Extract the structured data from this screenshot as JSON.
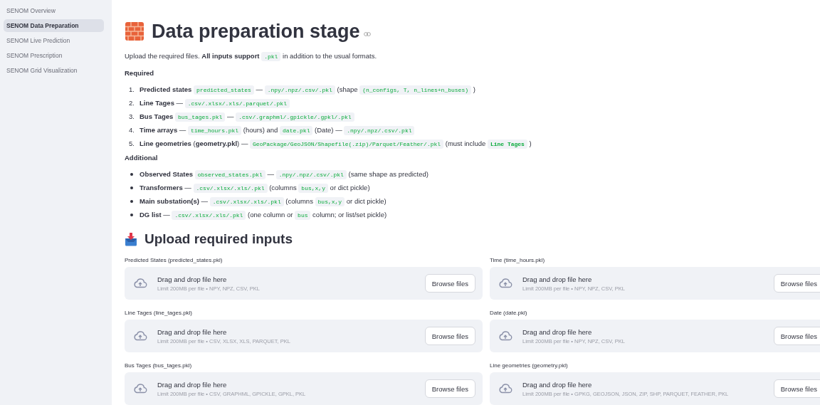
{
  "sidebar": {
    "items": [
      {
        "label": "SENOM Overview",
        "selected": false
      },
      {
        "label": "SENOM Data Preparation",
        "selected": true
      },
      {
        "label": "SENOM Live Prediction",
        "selected": false
      },
      {
        "label": "SENOM Prescription",
        "selected": false
      },
      {
        "label": "SENOM Grid Visualization",
        "selected": false
      }
    ]
  },
  "title": "Data preparation stage",
  "intro": [
    {
      "kind": "text",
      "text": "Upload the required files. "
    },
    {
      "kind": "bold",
      "text": "All inputs support "
    },
    {
      "kind": "code",
      "text": ".pkl"
    },
    {
      "kind": "text",
      "text": " in addition to the usual formats."
    }
  ],
  "required": {
    "heading": "Required",
    "items": [
      {
        "number": "1.",
        "parts": [
          {
            "kind": "bold",
            "text": "Predicted states "
          },
          {
            "kind": "code",
            "text": "predicted_states"
          },
          {
            "kind": "text",
            "text": " — "
          },
          {
            "kind": "code",
            "text": ".npy/.npz/.csv/.pkl"
          },
          {
            "kind": "text",
            "text": " (shape "
          },
          {
            "kind": "code",
            "text": "(n_configs, T, n_lines+n_buses)"
          },
          {
            "kind": "text",
            "text": " )"
          }
        ]
      },
      {
        "number": "2.",
        "parts": [
          {
            "kind": "bold",
            "text": "Line Tages"
          },
          {
            "kind": "text",
            "text": " — "
          },
          {
            "kind": "code",
            "text": ".csv/.xlsx/.xls/.parquet/.pkl"
          }
        ]
      },
      {
        "number": "3.",
        "parts": [
          {
            "kind": "bold",
            "text": "Bus Tages "
          },
          {
            "kind": "code",
            "text": "bus_tages.pkl"
          },
          {
            "kind": "text",
            "text": " — "
          },
          {
            "kind": "code",
            "text": ".csv/.graphml/.gpickle/.gpkl/.pkl"
          }
        ]
      },
      {
        "number": "4.",
        "parts": [
          {
            "kind": "bold",
            "text": "Time arrays"
          },
          {
            "kind": "text",
            "text": " — "
          },
          {
            "kind": "code",
            "text": "time_hours.pkl"
          },
          {
            "kind": "text",
            "text": " (hours) and "
          },
          {
            "kind": "code",
            "text": "date.pkl"
          },
          {
            "kind": "text",
            "text": " (Date) — "
          },
          {
            "kind": "code",
            "text": ".npy/.npz/.csv/.pkl"
          }
        ]
      },
      {
        "number": "5.",
        "parts": [
          {
            "kind": "bold",
            "text": "Line geometries"
          },
          {
            "kind": "text",
            "text": " ("
          },
          {
            "kind": "bold",
            "text": "geometry.pkl"
          },
          {
            "kind": "text",
            "text": ") — "
          },
          {
            "kind": "code",
            "text": "GeoPackage/GeoJSON/Shapefile(.zip)/Parquet/Feather/.pkl"
          },
          {
            "kind": "text",
            "text": " (must include "
          },
          {
            "kind": "boldcode",
            "text": "Line Tages"
          },
          {
            "kind": "text",
            "text": " )"
          }
        ]
      }
    ]
  },
  "additional": {
    "heading": "Additional",
    "items": [
      {
        "parts": [
          {
            "kind": "bold",
            "text": "Observed States "
          },
          {
            "kind": "code",
            "text": "observed_states.pkl"
          },
          {
            "kind": "text",
            "text": " — "
          },
          {
            "kind": "code",
            "text": ".npy/.npz/.csv/.pkl"
          },
          {
            "kind": "text",
            "text": " (same shape as predicted)"
          }
        ]
      },
      {
        "parts": [
          {
            "kind": "bold",
            "text": "Transformers"
          },
          {
            "kind": "text",
            "text": " — "
          },
          {
            "kind": "code",
            "text": ".csv/.xlsx/.xls/.pkl"
          },
          {
            "kind": "text",
            "text": " (columns "
          },
          {
            "kind": "code",
            "text": "bus,x,y"
          },
          {
            "kind": "text",
            "text": " or dict pickle)"
          }
        ]
      },
      {
        "parts": [
          {
            "kind": "bold",
            "text": "Main substation(s)"
          },
          {
            "kind": "text",
            "text": " — "
          },
          {
            "kind": "code",
            "text": ".csv/.xlsx/.xls/.pkl"
          },
          {
            "kind": "text",
            "text": " (columns "
          },
          {
            "kind": "code",
            "text": "bus,x,y"
          },
          {
            "kind": "text",
            "text": " or dict pickle)"
          }
        ]
      },
      {
        "parts": [
          {
            "kind": "bold",
            "text": "DG list"
          },
          {
            "kind": "text",
            "text": " — "
          },
          {
            "kind": "code",
            "text": ".csv/.xlsx/.xls/.pkl"
          },
          {
            "kind": "text",
            "text": " (one column or "
          },
          {
            "kind": "code",
            "text": "bus"
          },
          {
            "kind": "text",
            "text": " column; or list/set pickle)"
          }
        ]
      }
    ]
  },
  "upload": {
    "heading": "Upload required inputs",
    "uploaders": [
      {
        "label": "Predicted States (predicted_states.pkl)",
        "drop_text": "Drag and drop file here",
        "limit": "Limit 200MB per file • NPY, NPZ, CSV, PKL",
        "button": "Browse files"
      },
      {
        "label": "Time (time_hours.pkl)",
        "drop_text": "Drag and drop file here",
        "limit": "Limit 200MB per file • NPY, NPZ, CSV, PKL",
        "button": "Browse files"
      },
      {
        "label": "Line Tages (line_tages.pkl)",
        "drop_text": "Drag and drop file here",
        "limit": "Limit 200MB per file • CSV, XLSX, XLS, PARQUET, PKL",
        "button": "Browse files"
      },
      {
        "label": "Date (date.pkl)",
        "drop_text": "Drag and drop file here",
        "limit": "Limit 200MB per file • NPY, NPZ, CSV, PKL",
        "button": "Browse files"
      },
      {
        "label": "Bus Tages (bus_tages.pkl)",
        "drop_text": "Drag and drop file here",
        "limit": "Limit 200MB per file • CSV, GRAPHML, GPICKLE, GPKL, PKL",
        "button": "Browse files"
      },
      {
        "label": "Line geometries (geometry.pkl)",
        "drop_text": "Drag and drop file here",
        "limit": "Limit 200MB per file • GPKG, GEOJSON, JSON, ZIP, SHP, PARQUET, FEATHER, PKL",
        "button": "Browse files"
      }
    ]
  }
}
